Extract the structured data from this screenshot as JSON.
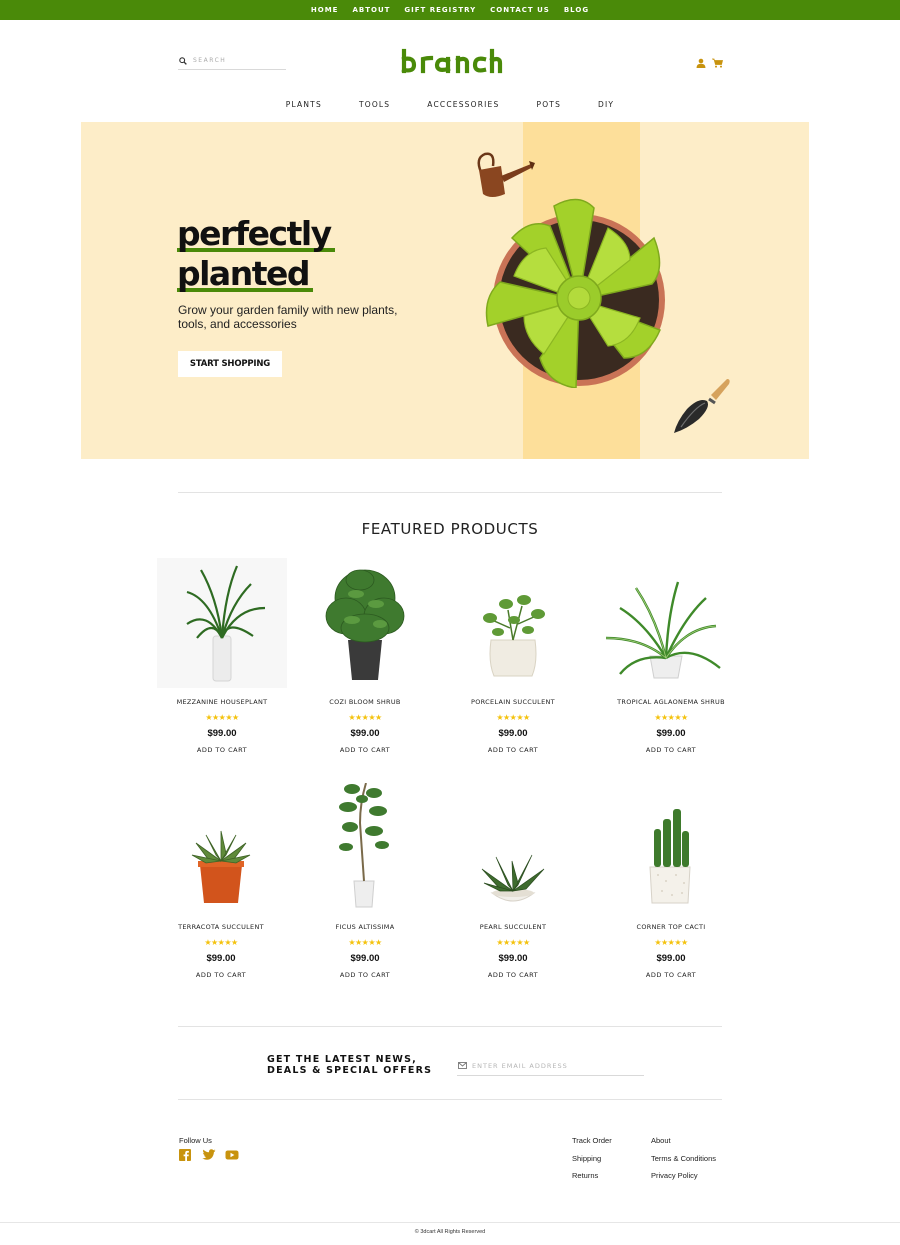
{
  "topnav": [
    "HOME",
    "ABTOUT",
    "GIFT REGISTRY",
    "CONTACT US",
    "BLOG"
  ],
  "header": {
    "search_placeholder": "SEARCH",
    "logo_text": "branch",
    "account_icon": "user-icon",
    "cart_icon": "cart-icon"
  },
  "mainnav": [
    "PLANTS",
    "TOOLS",
    "ACCCESSORIES",
    "POTS",
    "DIY"
  ],
  "hero": {
    "title_line1": "perfectly",
    "title_line2": "planted",
    "subtitle": "Grow your garden family with new plants, tools, and accessories",
    "cta": "START SHOPPING"
  },
  "featured": {
    "title": "FEATURED PRODUCTS",
    "rating_stars": "★★★★★",
    "add_to_cart": "ADD TO CART",
    "products": [
      {
        "name": "MEZZANINE HOUSEPLANT",
        "price": "$99.00",
        "rating": 5
      },
      {
        "name": "COZI BLOOM SHRUB",
        "price": "$99.00",
        "rating": 5
      },
      {
        "name": "PORCELAIN SUCCULENT",
        "price": "$99.00",
        "rating": 5
      },
      {
        "name": "TROPICAL AGLAONEMA SHRUB",
        "price": "$99.00",
        "rating": 5
      },
      {
        "name": "TERRACOTA SUCCULENT",
        "price": "$99.00",
        "rating": 5
      },
      {
        "name": "FICUS ALTISSIMA",
        "price": "$99.00",
        "rating": 5
      },
      {
        "name": "PEARL SUCCULENT",
        "price": "$99.00",
        "rating": 5
      },
      {
        "name": "CORNER TOP CACTI",
        "price": "$99.00",
        "rating": 5
      }
    ]
  },
  "newsletter": {
    "text": "GET THE LATEST NEWS, DEALS & SPECIAL OFFERS",
    "email_placeholder": "ENTER EMAIL ADDRESS"
  },
  "footer": {
    "follow_label": "Follow Us",
    "social_icons": [
      "facebook-icon",
      "twitter-icon",
      "youtube-icon"
    ],
    "links_col1": [
      "Track Order",
      "Shipping",
      "Returns"
    ],
    "links_col2": [
      "About",
      "Terms & Conditions",
      "Privacy Policy"
    ],
    "copyright": "© 3dcart All Rights Reserved"
  },
  "colors": {
    "brand_green": "#4a8a09",
    "hero_bg": "#fdedc8",
    "hero_stripe": "#fddf9a",
    "accent_gold": "#c8930e",
    "star": "#f4c20d"
  }
}
